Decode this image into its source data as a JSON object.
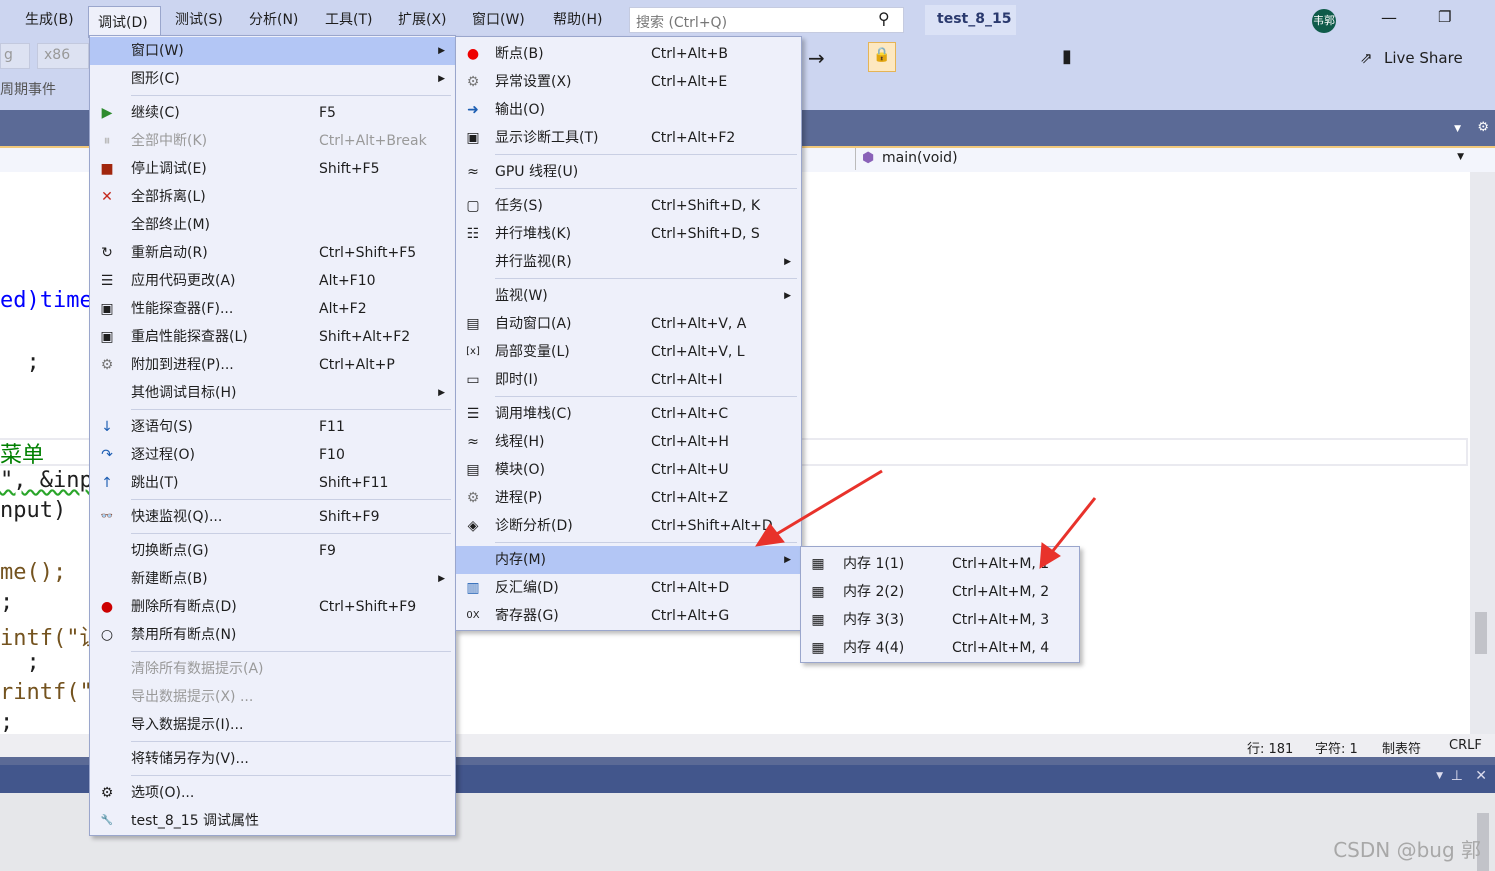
{
  "menubar": {
    "items": [
      "生成(B)",
      "调试(D)",
      "测试(S)",
      "分析(N)",
      "工具(T)",
      "扩展(X)",
      "窗口(W)",
      "帮助(H)"
    ],
    "search_placeholder": "搜索 (Ctrl+Q)",
    "project": "test_8_15",
    "avatar": "韦郭",
    "live_share": "Live Share"
  },
  "toolbar": {
    "config": "g",
    "platform": "x86",
    "lifecycle": "周期事件"
  },
  "editor": {
    "function_scope": "main(void)",
    "code_lines": [
      "ed)time",
      "  ;",
      "菜单",
      "\", &inp",
      "nput)",
      "me();",
      ";",
      "intf(\"让",
      "  ;",
      "rintf(\"",
      ";"
    ]
  },
  "status": {
    "line": "行: 181",
    "char": "字符: 1",
    "tabs": "制表符",
    "eol": "CRLF"
  },
  "watermark": "CSDN @bug 郭",
  "debug_menu": [
    {
      "label": "窗口(W)",
      "arrow": true,
      "hl": true
    },
    {
      "label": "图形(C)",
      "arrow": true
    },
    {
      "sep": true
    },
    {
      "icon": "▶",
      "icon_name": "continue-icon",
      "color": "#2e8b2e",
      "label": "继续(C)",
      "shortcut": "F5"
    },
    {
      "icon": "⏸",
      "icon_name": "break-all-icon",
      "color": "#bbb",
      "label": "全部中断(K)",
      "shortcut": "Ctrl+Alt+Break",
      "disabled": true
    },
    {
      "icon": "■",
      "icon_name": "stop-icon",
      "color": "#a1260d",
      "label": "停止调试(E)",
      "shortcut": "Shift+F5"
    },
    {
      "icon": "✕",
      "icon_name": "detach-all-icon",
      "color": "#c4281c",
      "label": "全部拆离(L)"
    },
    {
      "label": "全部终止(M)"
    },
    {
      "icon": "↻",
      "icon_name": "restart-icon",
      "label": "重新启动(R)",
      "shortcut": "Ctrl+Shift+F5"
    },
    {
      "icon": "☰",
      "icon_name": "apply-code-changes-icon",
      "label": "应用代码更改(A)",
      "shortcut": "Alt+F10"
    },
    {
      "icon": "▣",
      "icon_name": "profiler-icon",
      "label": "性能探查器(F)...",
      "shortcut": "Alt+F2"
    },
    {
      "icon": "▣",
      "icon_name": "relaunch-profiler-icon",
      "label": "重启性能探查器(L)",
      "shortcut": "Shift+Alt+F2"
    },
    {
      "icon": "⚙",
      "icon_name": "attach-process-icon",
      "color": "#777",
      "label": "附加到进程(P)...",
      "shortcut": "Ctrl+Alt+P"
    },
    {
      "label": "其他调试目标(H)",
      "arrow": true
    },
    {
      "sep": true
    },
    {
      "icon": "↓",
      "icon_name": "step-into-icon",
      "color": "#1e5fb3",
      "label": "逐语句(S)",
      "shortcut": "F11"
    },
    {
      "icon": "↷",
      "icon_name": "step-over-icon",
      "color": "#1e5fb3",
      "label": "逐过程(O)",
      "shortcut": "F10"
    },
    {
      "icon": "↑",
      "icon_name": "step-out-icon",
      "color": "#1e5fb3",
      "label": "跳出(T)",
      "shortcut": "Shift+F11"
    },
    {
      "sep": true
    },
    {
      "icon": "👓",
      "icon_name": "quick-watch-icon",
      "label": "快速监视(Q)...",
      "shortcut": "Shift+F9"
    },
    {
      "sep": true
    },
    {
      "label": "切换断点(G)",
      "shortcut": "F9"
    },
    {
      "label": "新建断点(B)",
      "arrow": true
    },
    {
      "icon": "●",
      "icon_name": "delete-breakpoints-icon",
      "color": "#c00",
      "label": "删除所有断点(D)",
      "shortcut": "Ctrl+Shift+F9"
    },
    {
      "icon": "○",
      "icon_name": "disable-breakpoints-icon",
      "label": "禁用所有断点(N)"
    },
    {
      "sep": true
    },
    {
      "label": "清除所有数据提示(A)",
      "disabled": true
    },
    {
      "label": "导出数据提示(X) ...",
      "disabled": true
    },
    {
      "label": "导入数据提示(I)..."
    },
    {
      "sep": true
    },
    {
      "label": "将转储另存为(V)..."
    },
    {
      "sep": true
    },
    {
      "icon": "⚙",
      "icon_name": "options-gear-icon",
      "label": "选项(O)..."
    },
    {
      "icon": "🔧",
      "icon_name": "wrench-icon",
      "label": "test_8_15 调试属性"
    }
  ],
  "windows_menu": [
    {
      "icon": "●",
      "icon_name": "breakpoints-icon",
      "color": "#e00",
      "label": "断点(B)",
      "shortcut": "Ctrl+Alt+B"
    },
    {
      "icon": "⚙",
      "icon_name": "exception-settings-icon",
      "color": "#777",
      "label": "异常设置(X)",
      "shortcut": "Ctrl+Alt+E"
    },
    {
      "icon": "➜",
      "icon_name": "output-icon",
      "color": "#1e5fb3",
      "label": "输出(O)"
    },
    {
      "icon": "▣",
      "icon_name": "diagnostic-tools-icon",
      "label": "显示诊断工具(T)",
      "shortcut": "Ctrl+Alt+F2"
    },
    {
      "sep": true
    },
    {
      "icon": "≈",
      "icon_name": "gpu-threads-icon",
      "label": "GPU 线程(U)"
    },
    {
      "sep": true
    },
    {
      "icon": "▢",
      "icon_name": "tasks-icon",
      "label": "任务(S)",
      "shortcut": "Ctrl+Shift+D, K"
    },
    {
      "icon": "☷",
      "icon_name": "parallel-stacks-icon",
      "label": "并行堆栈(K)",
      "shortcut": "Ctrl+Shift+D, S"
    },
    {
      "label": "并行监视(R)",
      "arrow": true
    },
    {
      "sep": true
    },
    {
      "label": "监视(W)",
      "arrow": true
    },
    {
      "icon": "▤",
      "icon_name": "autos-icon",
      "label": "自动窗口(A)",
      "shortcut": "Ctrl+Alt+V, A"
    },
    {
      "icon": "[x]",
      "icon_name": "locals-icon",
      "label": "局部变量(L)",
      "shortcut": "Ctrl+Alt+V, L"
    },
    {
      "icon": "▭",
      "icon_name": "immediate-icon",
      "label": "即时(I)",
      "shortcut": "Ctrl+Alt+I"
    },
    {
      "sep": true
    },
    {
      "icon": "☰",
      "icon_name": "call-stack-icon",
      "label": "调用堆栈(C)",
      "shortcut": "Ctrl+Alt+C"
    },
    {
      "icon": "≈",
      "icon_name": "threads-icon",
      "label": "线程(H)",
      "shortcut": "Ctrl+Alt+H"
    },
    {
      "icon": "▤",
      "icon_name": "modules-icon",
      "label": "模块(O)",
      "shortcut": "Ctrl+Alt+U"
    },
    {
      "icon": "⚙",
      "icon_name": "processes-icon",
      "color": "#777",
      "label": "进程(P)",
      "shortcut": "Ctrl+Alt+Z"
    },
    {
      "icon": "◈",
      "icon_name": "diagnostic-analysis-icon",
      "label": "诊断分析(D)",
      "shortcut": "Ctrl+Shift+Alt+D"
    },
    {
      "sep": true
    },
    {
      "label": "内存(M)",
      "arrow": true,
      "hl": true
    },
    {
      "icon": "▥",
      "icon_name": "disassembly-icon",
      "color": "#1e5fb3",
      "label": "反汇编(D)",
      "shortcut": "Ctrl+Alt+D"
    },
    {
      "icon": "0X",
      "icon_name": "registers-icon",
      "label": "寄存器(G)",
      "shortcut": "Ctrl+Alt+G"
    }
  ],
  "memory_menu": [
    {
      "icon": "▦",
      "icon_name": "memory-icon",
      "label": "内存 1(1)",
      "shortcut": "Ctrl+Alt+M, 1"
    },
    {
      "icon": "▦",
      "icon_name": "memory-icon",
      "label": "内存 2(2)",
      "shortcut": "Ctrl+Alt+M, 2"
    },
    {
      "icon": "▦",
      "icon_name": "memory-icon",
      "label": "内存 3(3)",
      "shortcut": "Ctrl+Alt+M, 3"
    },
    {
      "icon": "▦",
      "icon_name": "memory-icon",
      "label": "内存 4(4)",
      "shortcut": "Ctrl+Alt+M, 4"
    }
  ],
  "colors": {
    "menu_bg": "#eef0fa",
    "highlight": "#b3c6f5",
    "annotation_arrow": "#e8322b"
  }
}
